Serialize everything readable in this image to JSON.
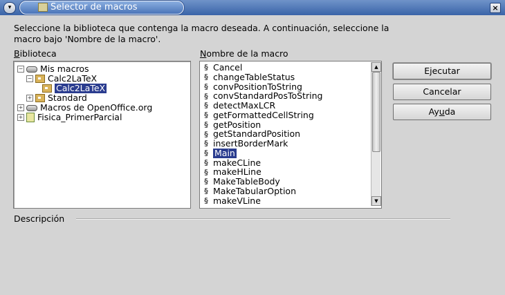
{
  "window": {
    "title": "Selector de macros",
    "close_glyph": "×",
    "menu_glyph": "▾"
  },
  "instruction": "Seleccione la biblioteca que contenga la macro deseada. A continuación, seleccione la macro bajo 'Nombre de la macro'.",
  "library_label": {
    "accel": "B",
    "rest": "iblioteca"
  },
  "macro_label": {
    "accel": "N",
    "rest": "ombre de la macro"
  },
  "tree": [
    {
      "label": "Mis macros",
      "toggle": "−",
      "icon": "library-icon"
    },
    {
      "label": "Calc2LaTeX",
      "toggle": "−",
      "icon": "folder-icon"
    },
    {
      "label": "Calc2LaTeX",
      "toggle": "",
      "icon": "folder-icon",
      "selected": true
    },
    {
      "label": "Standard",
      "toggle": "+",
      "icon": "folder-icon"
    },
    {
      "label": "Macros de OpenOffice.org",
      "toggle": "+",
      "icon": "library-icon"
    },
    {
      "label": "Fisica_PrimerParcial",
      "toggle": "+",
      "icon": "document-icon"
    }
  ],
  "macros": [
    "Cancel",
    "changeTableStatus",
    "convPositionToString",
    "convStandardPosToString",
    "detectMaxLCR",
    "getFormattedCellString",
    "getPosition",
    "getStandardPosition",
    "insertBorderMark",
    "Main",
    "makeCLine",
    "makeHLine",
    "MakeTableBody",
    "MakeTabularOption",
    "makeVLine"
  ],
  "selected_macro": "Main",
  "buttons": {
    "run": "Ejecutar",
    "cancel": "Cancelar",
    "help_pre": "Ay",
    "help_accel": "u",
    "help_post": "da"
  },
  "description_label": "Descripción",
  "colors": {
    "titlebar": "#3a64a8",
    "selection": "#2a3c8f"
  },
  "icons": {
    "macro": "macro-script-icon",
    "scroll_up": "▲",
    "scroll_down": "▼"
  }
}
